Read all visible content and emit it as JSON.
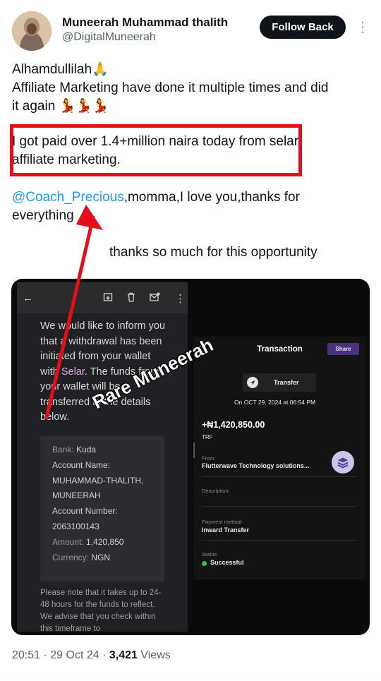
{
  "header": {
    "display_name": "Muneerah Muhammad thalith",
    "handle": "@DigitalMuneerah",
    "follow_label": "Follow Back",
    "more_icon": "more-vertical-icon",
    "avatar_icon": "user-avatar"
  },
  "tweet": {
    "line1_text": "Alhamdullilah",
    "line1_emoji": "🙏",
    "line2": "Affiliate Marketing have done it multiple times and did",
    "line3_text": "it again",
    "line3_emoji": "💃💃💃",
    "highlight_line1": "I got paid over 1.4+million naira today from selar",
    "highlight_line2": "affiliate marketing.",
    "mention": "@Coach_Precious",
    "mention_rest": ",momma,I love you,thanks for",
    "line_everything": "everything",
    "thanks_line": "thanks so much for this opportunity"
  },
  "media": {
    "email": {
      "toolbar_icons": [
        "back-arrow-icon",
        "archive-icon",
        "trash-icon",
        "mark-unread-icon",
        "more-vertical-icon"
      ],
      "body_part1": "We would like to inform you that a withdrawal has been initiated from your wallet with ",
      "body_selar": "Selar",
      "body_part2": ". The funds from your wallet will be transferred to the details below.",
      "account": {
        "bank_label": "Bank:",
        "bank_value": "Kuda",
        "name_label": "Account Name:",
        "name_value_1": "MUHAMMAD-THALITH,",
        "name_value_2": "MUNEERAH",
        "number_label": "Account Number:",
        "number_value": "2063100143",
        "amount_label": "Amount:",
        "amount_value": "1,420,850",
        "currency_label": "Currency:",
        "currency_value": "NGN"
      },
      "note": "Please note that it takes up to 24-48 hours for the funds to reflect. We advise that you check within this timeframe to"
    },
    "transaction": {
      "title": "Transaction",
      "share_label": "Share",
      "type": "Transfer",
      "date": "On OCT 29, 2024 at 06:54 PM",
      "amount": "+₦1,420,850.00",
      "code": "TRF",
      "from_label": "From",
      "from_value": "Flutterwave Technology solutions...",
      "description_label": "Description:",
      "payment_method_label": "Payment method",
      "payment_method_value": "Inward Transfer",
      "status_label": "Status",
      "status_value": "Successful",
      "status_color": "#22c55e"
    },
    "watermark": "Rare Muneerah"
  },
  "footer": {
    "time_date": "20:51 · 29 Oct 24 · ",
    "views_count": "3,421",
    "views_label": " Views"
  },
  "colors": {
    "accent_link": "#1d9bf0",
    "highlight_red": "#e3101c",
    "share_purple": "#4a2f83"
  }
}
